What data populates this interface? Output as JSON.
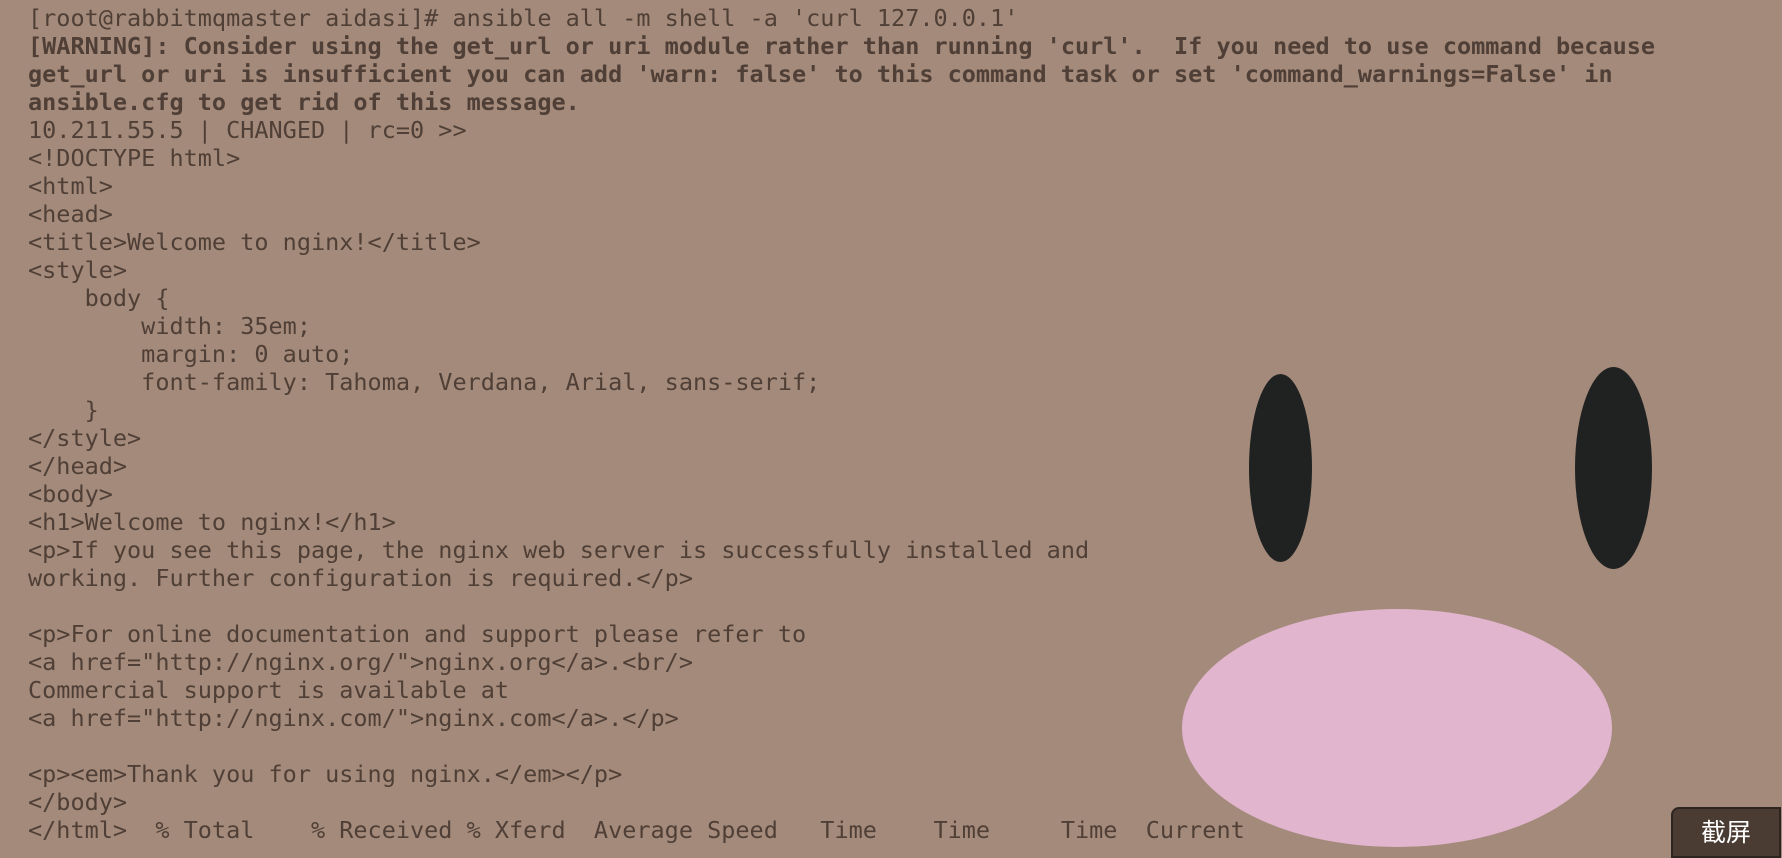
{
  "terminal": {
    "lines": [
      {
        "text": "[root@rabbitmqmaster aidasi]# ansible all -m shell -a 'curl 127.0.0.1'",
        "bold": false
      },
      {
        "text": "[WARNING]: Consider using the get_url or uri module rather than running 'curl'.  If you need to use command because",
        "bold": true
      },
      {
        "text": "get_url or uri is insufficient you can add 'warn: false' to this command task or set 'command_warnings=False' in",
        "bold": true
      },
      {
        "text": "ansible.cfg to get rid of this message.",
        "bold": true
      },
      {
        "text": "10.211.55.5 | CHANGED | rc=0 >>",
        "bold": false
      },
      {
        "text": "<!DOCTYPE html>",
        "bold": false
      },
      {
        "text": "<html>",
        "bold": false
      },
      {
        "text": "<head>",
        "bold": false
      },
      {
        "text": "<title>Welcome to nginx!</title>",
        "bold": false
      },
      {
        "text": "<style>",
        "bold": false
      },
      {
        "text": "    body {",
        "bold": false
      },
      {
        "text": "        width: 35em;",
        "bold": false
      },
      {
        "text": "        margin: 0 auto;",
        "bold": false
      },
      {
        "text": "        font-family: Tahoma, Verdana, Arial, sans-serif;",
        "bold": false
      },
      {
        "text": "    }",
        "bold": false
      },
      {
        "text": "</style>",
        "bold": false
      },
      {
        "text": "</head>",
        "bold": false
      },
      {
        "text": "<body>",
        "bold": false
      },
      {
        "text": "<h1>Welcome to nginx!</h1>",
        "bold": false
      },
      {
        "text": "<p>If you see this page, the nginx web server is successfully installed and",
        "bold": false
      },
      {
        "text": "working. Further configuration is required.</p>",
        "bold": false
      },
      {
        "text": "",
        "bold": false
      },
      {
        "text": "<p>For online documentation and support please refer to",
        "bold": false
      },
      {
        "text": "<a href=\"http://nginx.org/\">nginx.org</a>.<br/>",
        "bold": false
      },
      {
        "text": "Commercial support is available at",
        "bold": false
      },
      {
        "text": "<a href=\"http://nginx.com/\">nginx.com</a>.</p>",
        "bold": false
      },
      {
        "text": "",
        "bold": false
      },
      {
        "text": "<p><em>Thank you for using nginx.</em></p>",
        "bold": false
      },
      {
        "text": "</body>",
        "bold": false
      },
      {
        "text": "</html>  % Total    % Received % Xferd  Average Speed   Time    Time     Time  Current",
        "bold": false
      }
    ]
  },
  "screenshot_button": {
    "label": "截屏"
  },
  "colors": {
    "background": "#a48a7a",
    "text": "#4f3f36",
    "eyes": "#1f2221",
    "nose": "#e0b5cd",
    "button_bg": "#4a3b33"
  }
}
